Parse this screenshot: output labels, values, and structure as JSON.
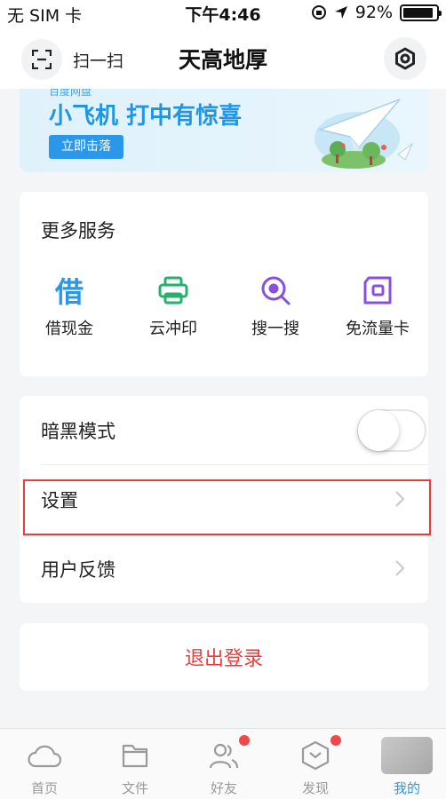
{
  "status_bar": {
    "carrier": "无 SIM 卡",
    "time": "下午4:46",
    "battery": "92%",
    "battery_level": 0.92
  },
  "nav": {
    "scan_label": "扫一扫",
    "title": "天高地厚"
  },
  "banner": {
    "top_text": "百度网盘",
    "title": "小飞机 打中有惊喜",
    "button": "立即击落"
  },
  "services": {
    "title": "更多服务",
    "items": [
      {
        "label": "借现金",
        "icon": "borrow-icon",
        "glyph": "借",
        "color": "#2a97e8"
      },
      {
        "label": "云冲印",
        "icon": "printer-icon",
        "color": "#25b06b"
      },
      {
        "label": "搜一搜",
        "icon": "search-icon",
        "color": "#8a4fe0"
      },
      {
        "label": "免流量卡",
        "icon": "sim-card-icon",
        "color": "#8a4fe0"
      }
    ]
  },
  "settings": {
    "dark_mode": {
      "label": "暗黑模式",
      "on": false
    },
    "settings": {
      "label": "设置"
    },
    "feedback": {
      "label": "用户反馈"
    }
  },
  "logout": {
    "label": "退出登录",
    "color": "#ea3d3d"
  },
  "tabbar": {
    "items": [
      {
        "label": "首页",
        "icon": "home-cloud-icon"
      },
      {
        "label": "文件",
        "icon": "folder-icon"
      },
      {
        "label": "好友",
        "icon": "friends-icon",
        "badge": true
      },
      {
        "label": "发现",
        "icon": "discover-icon",
        "badge": true
      },
      {
        "label": "我的",
        "icon": "avatar-icon",
        "active": true
      }
    ]
  },
  "highlight_color": "#e53e3e"
}
